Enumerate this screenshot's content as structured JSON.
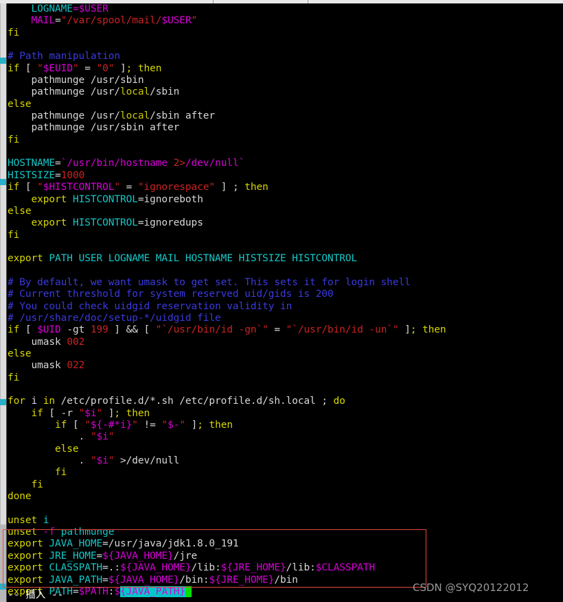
{
  "app": {
    "kind": "terminal-vim-editor",
    "file_context": "/etc/profile",
    "background": "#000000"
  },
  "colors": {
    "keyword": "#d7d700",
    "comment": "#3a3ae0",
    "variable": "#14c8c8",
    "expansion": "#d800d8",
    "string": "#cc2222",
    "plain": "#d8d8d8",
    "match_highlight_bg": "#00c8c8",
    "cursor": "#00e000",
    "annotation_box": "#e8493f",
    "watermark": "#9a9a9a"
  },
  "editor": {
    "lines": [
      "    LOGNAME=$USER",
      "    MAIL=\"/var/spool/mail/$USER\"",
      "fi",
      "",
      "# Path manipulation",
      "if [ \"$EUID\" = \"0\" ]; then",
      "    pathmunge /usr/sbin",
      "    pathmunge /usr/local/sbin",
      "else",
      "    pathmunge /usr/local/sbin after",
      "    pathmunge /usr/sbin after",
      "fi",
      "",
      "HOSTNAME=`/usr/bin/hostname 2>/dev/null`",
      "HISTSIZE=1000",
      "if [ \"$HISTCONTROL\" = \"ignorespace\" ] ; then",
      "    export HISTCONTROL=ignoreboth",
      "else",
      "    export HISTCONTROL=ignoredups",
      "fi",
      "",
      "export PATH USER LOGNAME MAIL HOSTNAME HISTSIZE HISTCONTROL",
      "",
      "# By default, we want umask to get set. This sets it for login shell",
      "# Current threshold for system reserved uid/gids is 200",
      "# You could check uidgid reservation validity in",
      "# /usr/share/doc/setup-*/uidgid file",
      "if [ $UID -gt 199 ] && [ \"`/usr/bin/id -gn`\" = \"`/usr/bin/id -un`\" ]; then",
      "    umask 002",
      "else",
      "    umask 022",
      "fi",
      "",
      "for i in /etc/profile.d/*.sh /etc/profile.d/sh.local ; do",
      "    if [ -r \"$i\" ]; then",
      "        if [ \"${-#*i}\" != \"$-\" ]; then",
      "            . \"$i\"",
      "        else",
      "            . \"$i\" >/dev/null",
      "        fi",
      "    fi",
      "done",
      "",
      "unset i",
      "unset -f pathmunge",
      "export JAVA_HOME=/usr/java/jdk1.8.0_191",
      "export JRE_HOME=${JAVA_HOME}/jre",
      "export CLASSPATH=.:${JAVA_HOME}/lib:${JRE_HOME}/lib:$CLASSPATH",
      "export JAVA_PATH=${JAVA_HOME}/bin:${JRE_HOME}/bin",
      "export PATH=$PATH:${JAVA_PATH}"
    ],
    "highlighted_block": {
      "description": "red annotation rectangle around the java environment exports",
      "first_line": "export JAVA_HOME=/usr/java/jdk1.8.0_191",
      "last_line": "export PATH=$PATH:${JAVA_PATH}",
      "line_count": 5
    },
    "cursor": {
      "line": "export PATH=$PATH:${JAVA_PATH}",
      "column_token": "end-of-line",
      "match_highlight_text": "{JAVA_PATH}"
    }
  },
  "status": {
    "mode_text": "-- 插入 --"
  },
  "watermark": {
    "text": "CSDN @SYQ20122012"
  }
}
